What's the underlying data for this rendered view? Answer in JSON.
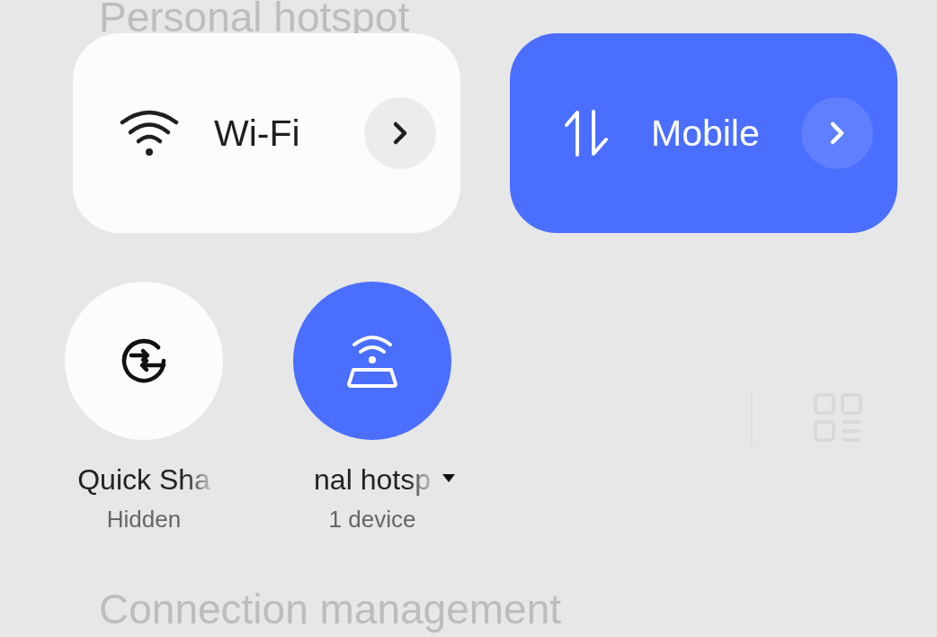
{
  "background": {
    "title": "Personal hotspot",
    "section": "Connection management"
  },
  "tiles": [
    {
      "label": "Wi-Fi",
      "kind": "wifi",
      "on": false
    },
    {
      "label": "Mobile",
      "kind": "data",
      "on": true
    }
  ],
  "toggles": [
    {
      "label": "Quick Sha",
      "status": "Hidden",
      "kind": "share",
      "on": false,
      "dropdown": false
    },
    {
      "label": "nal hotsp",
      "status": "1 device",
      "kind": "hotspot",
      "on": true,
      "dropdown": true
    }
  ]
}
